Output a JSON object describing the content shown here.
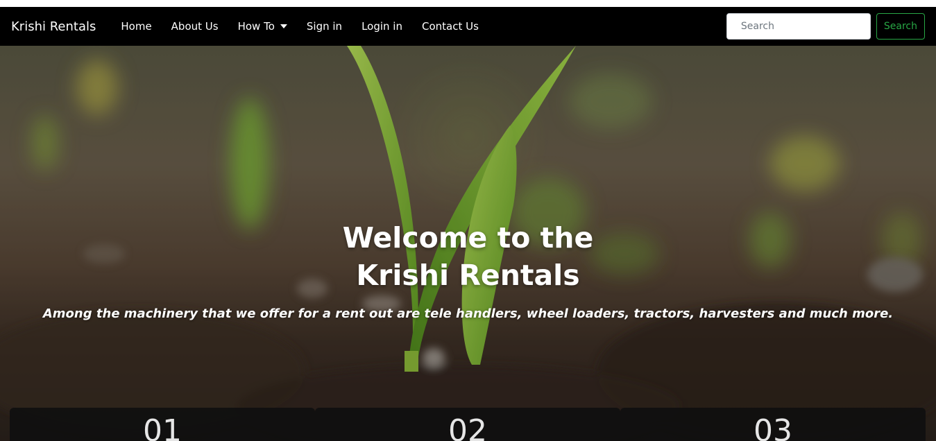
{
  "navbar": {
    "brand": "Krishi Rentals",
    "links": [
      {
        "label": "Home"
      },
      {
        "label": "About Us"
      },
      {
        "label": "How To"
      },
      {
        "label": "Sign in"
      },
      {
        "label": "Login in"
      },
      {
        "label": "Contact Us"
      }
    ],
    "search": {
      "placeholder": "Search",
      "button_label": "Search"
    }
  },
  "hero": {
    "title_line1": "Welcome to the",
    "title_line2": "Krishi Rentals",
    "subtitle": "Among the machinery that we offer for a rent out are tele handlers, wheel loaders, tractors, harvesters and much more."
  },
  "cards": [
    {
      "number": "01"
    },
    {
      "number": "02"
    },
    {
      "number": "03"
    }
  ],
  "colors": {
    "navbar_bg": "#000000",
    "search_accent": "#28a745"
  }
}
